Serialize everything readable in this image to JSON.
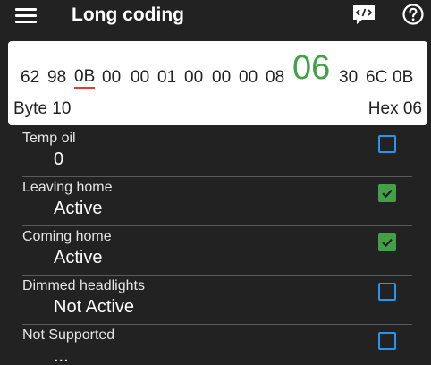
{
  "header": {
    "title": "Long coding",
    "menu_icon": "hamburger-menu-icon",
    "code_icon": "code-bubble-icon",
    "help_icon": "help-circle-icon"
  },
  "byte_panel": {
    "hex_bytes": [
      "62",
      "98",
      "0B",
      "00",
      "00",
      "01",
      "00",
      "00",
      "00",
      "08",
      "06",
      "30",
      "6C",
      "0B"
    ],
    "selected_index": 2,
    "highlighted_index": 10,
    "byte_label": "Byte 10",
    "hex_label": "Hex 06"
  },
  "options": [
    {
      "label": "Temp oil",
      "value": "0",
      "checked": false
    },
    {
      "label": "Leaving home",
      "value": "Active",
      "checked": true
    },
    {
      "label": "Coming home",
      "value": "Active",
      "checked": true
    },
    {
      "label": "Dimmed headlights",
      "value": "Not Active",
      "checked": false
    },
    {
      "label": "Not Supported",
      "value": "...",
      "checked": false
    }
  ],
  "colors": {
    "background": "#222222",
    "accent_green": "#43a047",
    "checkbox_blue": "#2196f3",
    "selected_underline": "#e53935"
  }
}
